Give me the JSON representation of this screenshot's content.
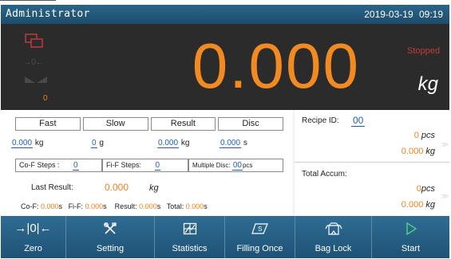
{
  "header": {
    "title": "Administrator",
    "date": "2019-03-19",
    "time": "09:19"
  },
  "display": {
    "weight": "0.000",
    "unit": "kg",
    "status": "Stopped",
    "counter": "0",
    "zero_indicator": "→0←",
    "colors": {
      "weight": "#f28a22",
      "status": "#c23b3b",
      "background": "#2b2b2b"
    }
  },
  "tabs": [
    {
      "label": "Fast"
    },
    {
      "label": "Slow"
    },
    {
      "label": "Result"
    },
    {
      "label": "Disc"
    }
  ],
  "values": {
    "fast_value": "0.000",
    "fast_unit": "kg",
    "slow_value": "0",
    "slow_unit": "g",
    "result_value": "0.000",
    "result_unit": "kg",
    "disc_value": "0.000",
    "disc_unit": "s"
  },
  "steps": {
    "cof_label": "Co-F Steps :",
    "cof_value": "0",
    "fif_label": "Fi-F Steps:",
    "fif_value": "0",
    "multi_label": "Multiple Disc:",
    "multi_value": "00",
    "multi_unit": "pcs"
  },
  "last_result": {
    "label": "Last Result:",
    "value": "0.000",
    "unit": "kg"
  },
  "footer": {
    "cof_label": "Co-F:",
    "cof_value": "0.000",
    "cof_unit": "s",
    "fif_label": "Fi-F:",
    "fif_value": "0.000",
    "fif_unit": "s",
    "result_label": "Result:",
    "result_value": "0.000",
    "result_unit": "s",
    "total_label": "Total:",
    "total_value": "0.000",
    "total_unit": "s"
  },
  "recipe": {
    "label": "Recipe ID:",
    "id": "00",
    "pcs_value": "0",
    "pcs_unit": "pcs",
    "kg_value": "0.000",
    "kg_unit": "kg"
  },
  "total_accum": {
    "label": "Total Accum:",
    "pcs_value": "0",
    "pcs_unit": "pcs",
    "kg_value": "0.000",
    "kg_unit": "kg"
  },
  "toolbar": [
    {
      "label": "Zero",
      "icon": "zero-icon"
    },
    {
      "label": "Setting",
      "icon": "tools-icon"
    },
    {
      "label": "Statistics",
      "icon": "statistics-icon"
    },
    {
      "label": "Filling Once",
      "icon": "filling-once-icon"
    },
    {
      "label": "Bag Lock",
      "icon": "bag-lock-icon"
    },
    {
      "label": "Start",
      "icon": "play-icon"
    }
  ]
}
